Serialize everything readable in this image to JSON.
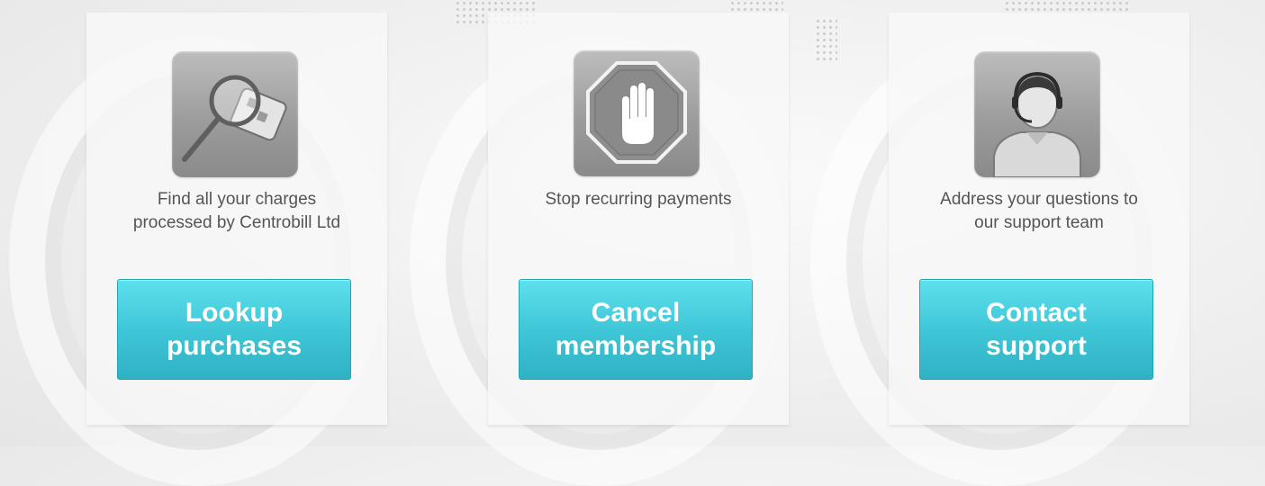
{
  "cards": [
    {
      "icon": "magnifier-card-icon",
      "description_lines": [
        "Find all your charges",
        "processed by Centrobill Ltd"
      ],
      "button_lines": [
        "Lookup",
        "purchases"
      ]
    },
    {
      "icon": "stop-hand-icon",
      "description_lines": [
        "Stop recurring payments"
      ],
      "button_lines": [
        "Cancel",
        "membership"
      ]
    },
    {
      "icon": "support-agent-icon",
      "description_lines": [
        "Address your questions to",
        "our support team"
      ],
      "button_lines": [
        "Contact",
        "support"
      ]
    }
  ],
  "colors": {
    "button_top": "#5ee0ee",
    "button_bottom": "#2fb1c4",
    "button_border": "#1fa9b6",
    "text": "#555555",
    "icon_tile": "#9c9c9c"
  }
}
